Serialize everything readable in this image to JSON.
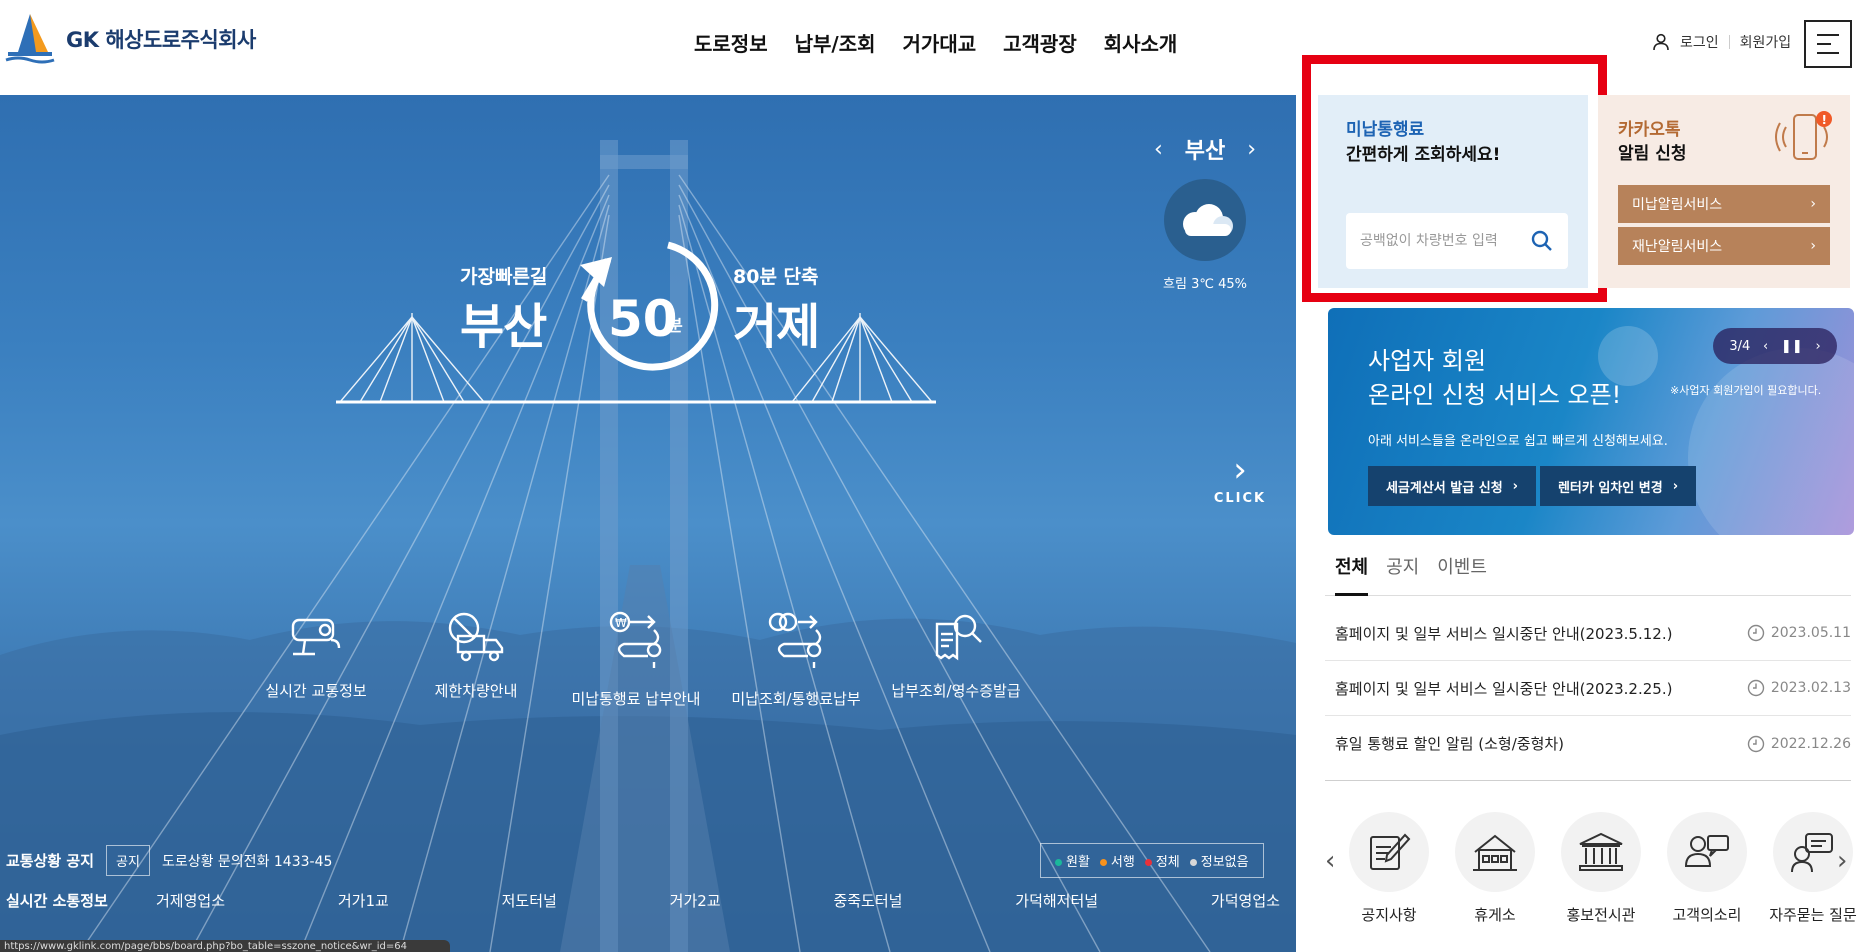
{
  "header": {
    "logo_text": "GK 해상도로주식회사",
    "nav": [
      "도로정보",
      "납부/조회",
      "거가대교",
      "고객광장",
      "회사소개"
    ],
    "login": "로그인",
    "signup": "회원가입"
  },
  "hero": {
    "left_sub": "가장빠른길",
    "left_main": "부산",
    "center_num": "50",
    "center_unit": "분",
    "right_sub": "80분 단축",
    "right_main": "거제",
    "weather": {
      "city": "부산",
      "prev": "‹",
      "next": "›",
      "info": "흐림 3℃ 45%"
    },
    "click_label": "CLICK",
    "quick_links": [
      {
        "label": "실시간 교통정보",
        "icon": "cctv-icon"
      },
      {
        "label": "제한차량안내",
        "icon": "restricted-truck-icon"
      },
      {
        "label": "미납통행료 납부안내",
        "icon": "unpaid-toll-route-icon"
      },
      {
        "label": "미납조회/통행료납부",
        "icon": "toll-payment-route-icon"
      },
      {
        "label": "납부조회/영수증발급",
        "icon": "receipt-search-icon"
      }
    ],
    "notice": {
      "title": "교통상황 공지",
      "tag": "공지",
      "text": "도로상황 문의전화 1433-45"
    },
    "legend": [
      {
        "label": "원활",
        "color": "#1bb89a"
      },
      {
        "label": "서행",
        "color": "#f6921e"
      },
      {
        "label": "정체",
        "color": "#e8313a"
      },
      {
        "label": "정보없음",
        "color": "#d8d8d8"
      }
    ],
    "traffic": {
      "title": "실시간 소통정보",
      "points": [
        "거제영업소",
        "거가1교",
        "저도터널",
        "거가2교",
        "중죽도터널",
        "가덕해저터널",
        "가덕영업소"
      ]
    },
    "status_url": "https://www.gklink.com/page/bbs/board.php?bo_table=sszone_notice&wr_id=64"
  },
  "unpaid": {
    "title": "미납통행료",
    "subtitle": "간편하게 조회하세요!",
    "placeholder": "공백없이 차량번호 입력"
  },
  "kakao": {
    "title": "카카오톡",
    "subtitle": "알림 신청",
    "buttons": [
      "미납알림서비스",
      "재난알림서비스"
    ],
    "badge": "!"
  },
  "banner": {
    "title_line1": "사업자 회원",
    "title_line2": "온라인 신청 서비스 오픈!",
    "note": "※사업자 회원가입이 필요합니다.",
    "desc": "아래 서비스들을 온라인으로 쉽고 빠르게 신청해보세요.",
    "btn1": "세금계산서 발급 신청",
    "btn2": "렌터카 임차인 변경",
    "pager": "3/4"
  },
  "tabs": [
    "전체",
    "공지",
    "이벤트"
  ],
  "news": [
    {
      "title": "홈페이지 및 일부 서비스 일시중단 안내(2023.5.12.)",
      "date": "2023.05.11"
    },
    {
      "title": "홈페이지 및 일부 서비스 일시중단 안내(2023.2.25.)",
      "date": "2023.02.13"
    },
    {
      "title": "휴일 통행료 할인 알림 (소형/중형차)",
      "date": "2022.12.26"
    }
  ],
  "bottom_icons": [
    {
      "label": "공지사항",
      "icon": "notice-pen-icon"
    },
    {
      "label": "휴게소",
      "icon": "rest-area-icon"
    },
    {
      "label": "홍보전시관",
      "icon": "exhibition-hall-icon"
    },
    {
      "label": "고객의소리",
      "icon": "customer-voice-icon"
    },
    {
      "label": "자주묻는 질문",
      "icon": "faq-icon"
    }
  ]
}
